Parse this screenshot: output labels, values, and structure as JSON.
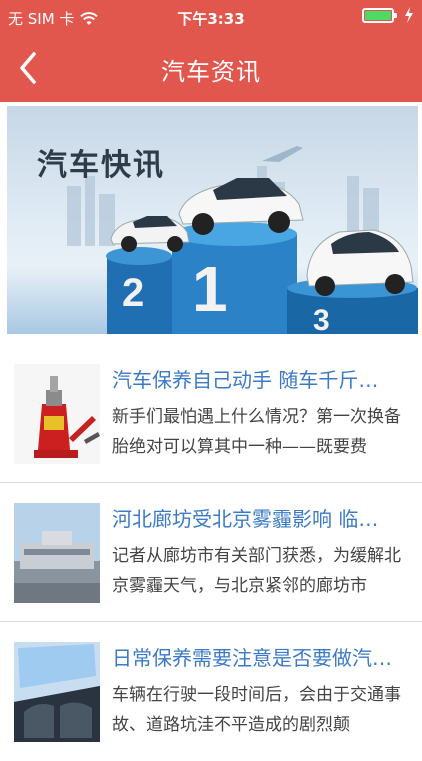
{
  "status_bar": {
    "carrier": "无 SIM 卡",
    "time": "下午3:33"
  },
  "navbar": {
    "title": "汽车资讯"
  },
  "banner": {
    "title": "汽车快讯",
    "podium_numbers": [
      "2",
      "1",
      "3"
    ]
  },
  "news": [
    {
      "title": "汽车保养自己动手 随车千斤…",
      "desc": "新手们最怕遇上什么情况？第一次换备胎绝对可以算其中一种——既要费"
    },
    {
      "title": "河北廊坊受北京雾霾影响 临…",
      "desc": "记者从廊坊市有关部门获悉，为缓解北京雾霾天气，与北京紧邻的廊坊市"
    },
    {
      "title": "日常保养需要注意是否要做汽…",
      "desc": "车辆在行驶一段时间后，会由于交通事故、道路坑洼不平造成的剧烈颠"
    }
  ],
  "colors": {
    "header": "#e2574d",
    "link_title": "#3a7ac8",
    "battery": "#4cd964"
  }
}
